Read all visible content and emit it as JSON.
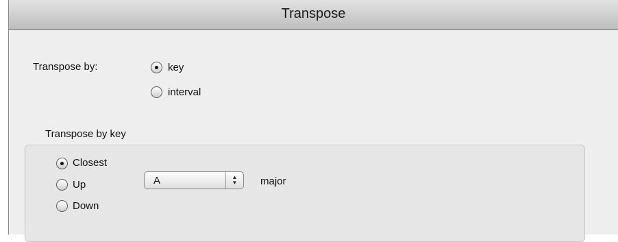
{
  "window": {
    "title": "Transpose"
  },
  "transpose_by": {
    "label": "Transpose by:",
    "options": [
      {
        "label": "key",
        "selected": true
      },
      {
        "label": "interval",
        "selected": false
      }
    ]
  },
  "key_group": {
    "title": "Transpose by key",
    "direction_options": [
      {
        "label": "Closest",
        "selected": true
      },
      {
        "label": "Up",
        "selected": false
      },
      {
        "label": "Down",
        "selected": false
      }
    ],
    "key_select": {
      "value": "A"
    },
    "mode_label": "major"
  }
}
